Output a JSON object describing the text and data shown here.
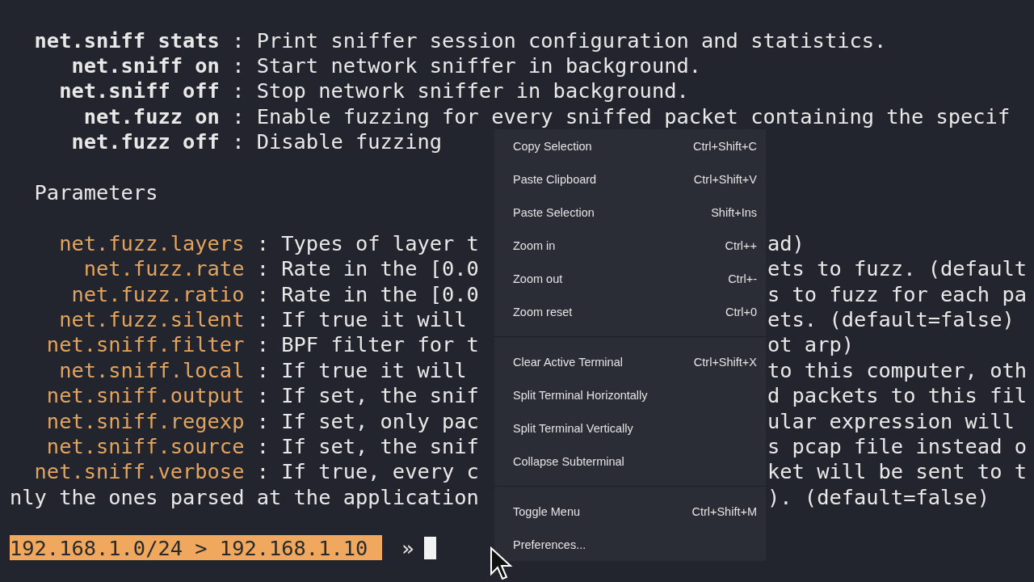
{
  "commands": [
    {
      "key": "net.sniff stats",
      "sep": ":",
      "text": "Print sniffer session configuration and statistics."
    },
    {
      "key": "net.sniff on",
      "sep": ":",
      "text": "Start network sniffer in background."
    },
    {
      "key": "net.sniff off",
      "sep": ":",
      "text": "Stop network sniffer in background."
    },
    {
      "key": "net.fuzz on",
      "sep": ":",
      "text": "Enable fuzzing for every sniffed packet containing the specif"
    },
    {
      "key": "net.fuzz off",
      "sep": ":",
      "text": "Disable fuzzing"
    }
  ],
  "parameters_heading": "Parameters",
  "parameters": [
    {
      "key": "net.fuzz.layers",
      "sep": ":",
      "text_left": "Types of layer t",
      "text_right": "ad)"
    },
    {
      "key": "net.fuzz.rate",
      "sep": ":",
      "text_left": "Rate in the [0.0",
      "text_right": "ets to fuzz. (default"
    },
    {
      "key": "net.fuzz.ratio",
      "sep": ":",
      "text_left": "Rate in the [0.0",
      "text_right": "s to fuzz for each pa"
    },
    {
      "key": "net.fuzz.silent",
      "sep": ":",
      "text_left": "If true it will",
      "text_right": "ets. (default=false)"
    },
    {
      "key": "net.sniff.filter",
      "sep": ":",
      "text_left": "BPF filter for t",
      "text_right": "ot arp)"
    },
    {
      "key": "net.sniff.local",
      "sep": ":",
      "text_left": "If true it will",
      "text_right": "to this computer, oth"
    },
    {
      "key": "net.sniff.output",
      "sep": ":",
      "text_left": "If set, the snif",
      "text_right": "d packets to this fil"
    },
    {
      "key": "net.sniff.regexp",
      "sep": ":",
      "text_left": "If set, only pac",
      "text_right": "ular expression will"
    },
    {
      "key": "net.sniff.source",
      "sep": ":",
      "text_left": "If set, the snif",
      "text_right": "s pcap file instead o"
    },
    {
      "key": "net.sniff.verbose",
      "sep": ":",
      "text_left": "If true, every c",
      "text_right": "ket will be sent to t"
    }
  ],
  "continuation": {
    "text_left": "nly the ones parsed at the application",
    "text_right": "). (default=false)"
  },
  "prompt": {
    "session": "192.168.1.0/24 > 192.168.1.10",
    "symbol": "»"
  },
  "context_menu": {
    "groups": [
      [
        {
          "label": "Copy Selection",
          "shortcut": "Ctrl+Shift+C"
        },
        {
          "label": "Paste Clipboard",
          "shortcut": "Ctrl+Shift+V"
        },
        {
          "label": "Paste Selection",
          "shortcut": "Shift+Ins"
        },
        {
          "label": "Zoom in",
          "shortcut": "Ctrl++"
        },
        {
          "label": "Zoom out",
          "shortcut": "Ctrl+-"
        },
        {
          "label": "Zoom reset",
          "shortcut": "Ctrl+0"
        }
      ],
      [
        {
          "label": "Clear Active Terminal",
          "shortcut": "Ctrl+Shift+X"
        },
        {
          "label": "Split Terminal Horizontally"
        },
        {
          "label": "Split Terminal Vertically"
        },
        {
          "label": "Collapse Subterminal"
        }
      ],
      [
        {
          "label": "Toggle Menu",
          "shortcut": "Ctrl+Shift+M"
        },
        {
          "label": "Preferences..."
        }
      ]
    ]
  }
}
